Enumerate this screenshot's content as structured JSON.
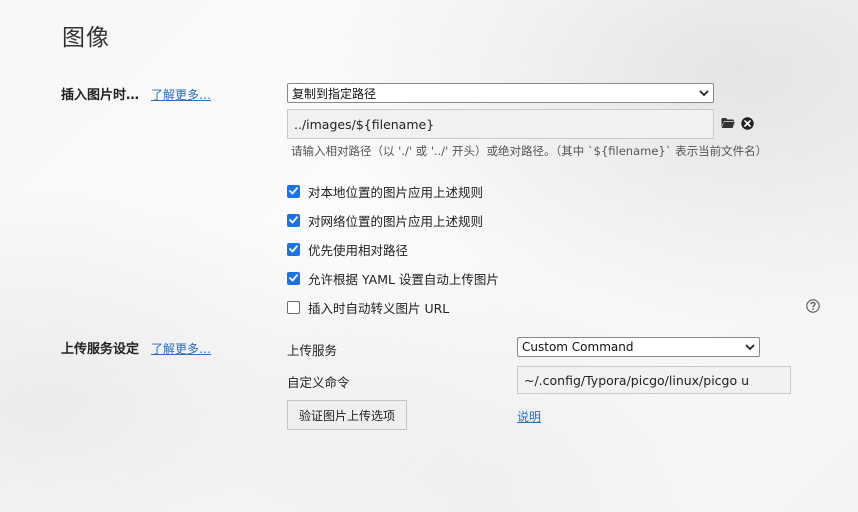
{
  "page": {
    "title": "图像"
  },
  "insert_section": {
    "label": "插入图片时…",
    "learn_more": "了解更多…",
    "action_select": {
      "value": "复制到指定路径"
    },
    "path_input": {
      "value": "../images/${filename}"
    },
    "hint": "请输入相对路径（以 './' 或 '../' 开头）或绝对路径。（其中 `${filename}` 表示当前文件名）",
    "options": [
      {
        "label": "对本地位置的图片应用上述规则",
        "checked": true
      },
      {
        "label": "对网络位置的图片应用上述规则",
        "checked": true
      },
      {
        "label": "优先使用相对路径",
        "checked": true
      },
      {
        "label": "允许根据 YAML 设置自动上传图片",
        "checked": true
      },
      {
        "label": "插入时自动转义图片 URL",
        "checked": false
      }
    ]
  },
  "upload_section": {
    "label": "上传服务设定",
    "learn_more": "了解更多…",
    "service_label": "上传服务",
    "service_select": {
      "value": "Custom Command"
    },
    "command_label": "自定义命令",
    "command_input": {
      "value": "~/.config/Typora/picgo/linux/picgo u"
    },
    "verify_button": "验证图片上传选项",
    "docs_link": "说明"
  },
  "colors": {
    "accent": "#1a73e8",
    "link": "#2a6ebb"
  },
  "icons": [
    "folder-icon",
    "clear-icon",
    "help-icon",
    "chevron-down-icon"
  ]
}
